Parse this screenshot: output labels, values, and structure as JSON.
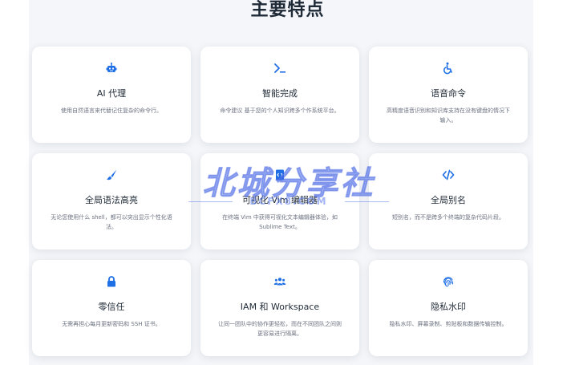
{
  "section": {
    "title": "主要特点"
  },
  "cards": [
    {
      "icon": "robot-icon",
      "title": "AI 代理",
      "desc": "使用自然语言来代替记住复杂的命令行。"
    },
    {
      "icon": "terminal-icon",
      "title": "智能完成",
      "desc": "命令建议 基于您的个人知识跨多个作系统平台。"
    },
    {
      "icon": "accessibility-icon",
      "title": "语音命令",
      "desc": "高精度语音识别和知识库支持在没有键盘的情况下输入。"
    },
    {
      "icon": "paintbrush-icon",
      "title": "全局语法高亮",
      "desc": "无论您使用什么 shell，都可以突出显示个性化语法。"
    },
    {
      "icon": "editor-icon",
      "title": "可视化 Vim 编辑器",
      "desc": "在终端 Vim 中获得可视化文本编辑器体验，如 Sublime Text。"
    },
    {
      "icon": "code-icon",
      "title": "全局别名",
      "desc": "短别名，而不是跨多个终端的复杂代码片段。"
    },
    {
      "icon": "lock-icon",
      "title": "零信任",
      "desc": "无需再担心每月更新密码和 SSH 证书。"
    },
    {
      "icon": "users-icon",
      "title": "IAM 和 Workspace",
      "desc": "让同一团队中的协作更轻松，而在不同团队之间则更容易进行隔离。"
    },
    {
      "icon": "fingerprint-icon",
      "title": "隐私水印",
      "desc": "隐私水印、屏幕录制、剪贴板和数据传输控制。"
    }
  ],
  "watermark": {
    "main": "北城分享社",
    "sub": "BCFX8.COM"
  },
  "colors": {
    "accent": "#1f6fe5",
    "background": "#f4f6f9",
    "card": "#ffffff"
  }
}
